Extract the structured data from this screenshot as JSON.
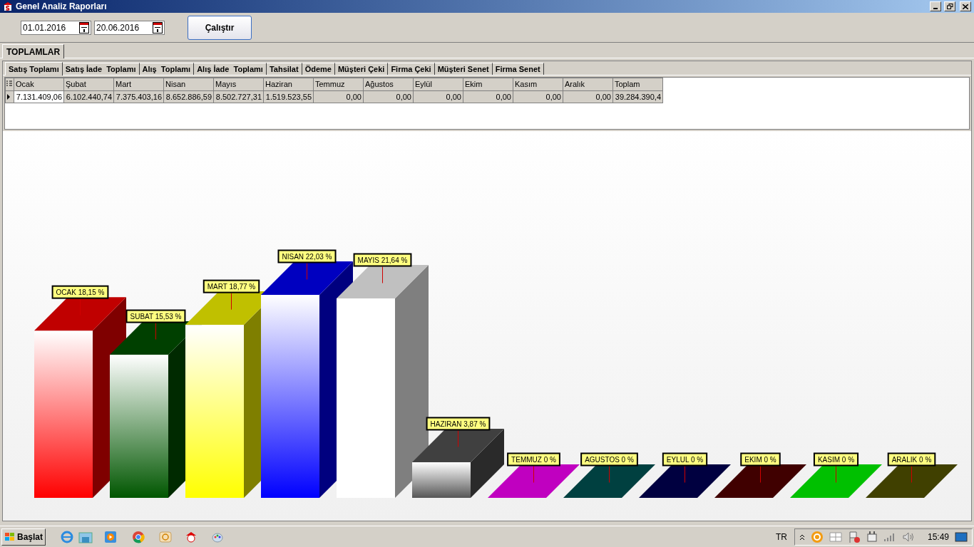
{
  "window": {
    "title": "Genel Analiz Raporları"
  },
  "toolbar": {
    "date_from": "01.01.2016",
    "date_to": "20.06.2016",
    "run_button": "Çalıştır"
  },
  "outer_tabs": [
    {
      "label": "TOPLAMLAR",
      "selected": true
    }
  ],
  "tabs": [
    {
      "label": "Satış Toplamı",
      "selected": true
    },
    {
      "label": "Satış İade  Toplamı",
      "selected": false
    },
    {
      "label": "Alış  Toplamı",
      "selected": false
    },
    {
      "label": "Alış İade  Toplamı",
      "selected": false
    },
    {
      "label": "Tahsilat",
      "selected": false
    },
    {
      "label": "Ödeme",
      "selected": false
    },
    {
      "label": "Müşteri Çeki",
      "selected": false
    },
    {
      "label": "Firma Çeki",
      "selected": false
    },
    {
      "label": "Müşteri Senet",
      "selected": false
    },
    {
      "label": "Firma Senet",
      "selected": false
    }
  ],
  "table": {
    "columns": [
      "Ocak",
      "Şubat",
      "Mart",
      "Nisan",
      "Mayıs",
      "Haziran",
      "Temmuz",
      "Ağustos",
      "Eylül",
      "Ekim",
      "Kasım",
      "Aralık",
      "Toplam"
    ],
    "rows": [
      {
        "selected": true,
        "cells": [
          "7.131.409,06",
          "6.102.440,74",
          "7.375.403,16",
          "8.652.886,59",
          "8.502.727,31",
          "1.519.523,55",
          "0,00",
          "0,00",
          "0,00",
          "0,00",
          "0,00",
          "0,00",
          "39.284.390,4"
        ]
      }
    ]
  },
  "chart": {
    "bars": [
      {
        "label": "OCAK 18,15 %",
        "color": "#c00000"
      },
      {
        "label": "SUBAT 15,53 %",
        "color": "#004000"
      },
      {
        "label": "MART 18,77 %",
        "color": "#c0c000"
      },
      {
        "label": "NISAN 22,03 %",
        "color": "#0000c0"
      },
      {
        "label": "MAYIS 21,64 %",
        "color": "#c0c0c0"
      },
      {
        "label": "HAZIRAN 3,87 %",
        "color": "#404040"
      },
      {
        "label": "TEMMUZ 0 %",
        "color": "#c000c0"
      },
      {
        "label": "AGUSTOS 0 %",
        "color": "#004040"
      },
      {
        "label": "EYLUL 0 %",
        "color": "#000040"
      },
      {
        "label": "EKIM 0 %",
        "color": "#400000"
      },
      {
        "label": "KASIM 0 %",
        "color": "#00c000"
      },
      {
        "label": "ARALIK 0 %",
        "color": "#404000"
      }
    ]
  },
  "taskbar": {
    "start_label": "Başlat",
    "language": "TR",
    "clock": "15:49"
  }
}
